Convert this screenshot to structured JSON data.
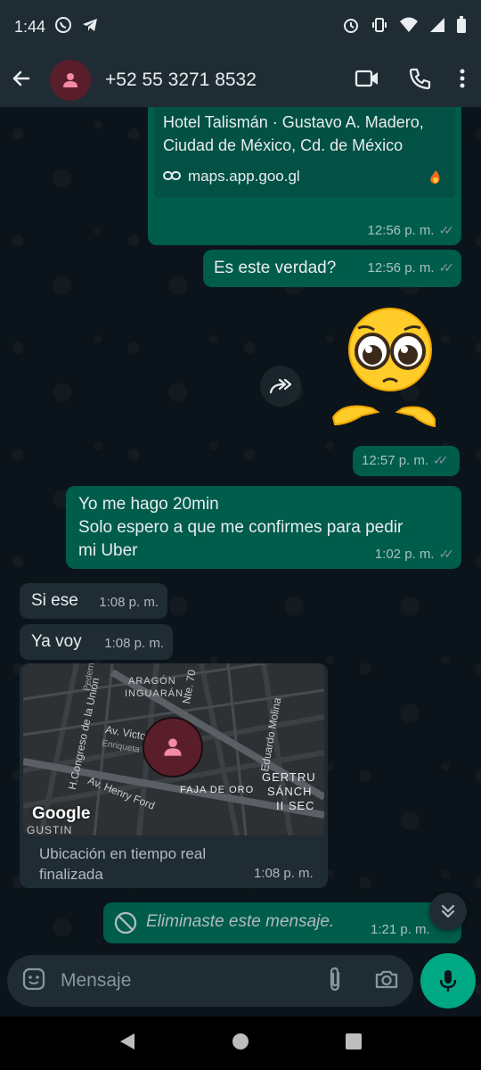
{
  "status_bar": {
    "time": "1:44"
  },
  "header": {
    "contact": "+52 55 3271 8532"
  },
  "messages": {
    "link": {
      "title": "Hotel Talismán · Gustavo A. Madero, Ciudad de México, Cd. de México",
      "title_line1": "Hotel Talismán · Gustavo A. Madero,",
      "title_line2": "Ciudad de México, Cd. de México",
      "url": "maps.app.goo.gl",
      "time": "12:56 p. m."
    },
    "m1": {
      "text": "Es este verdad?",
      "time": "12:56 p. m."
    },
    "sticker": {
      "time": "12:57 p. m."
    },
    "m2": {
      "line1": "Yo me hago 20min",
      "line2": "Solo espero a que me confirmes para pedir",
      "line3": "mi Uber",
      "time": "1:02 p. m."
    },
    "m3": {
      "text": "Si ese",
      "time": "1:08 p. m."
    },
    "m4": {
      "text": "Ya voy",
      "time": "1:08 p. m."
    },
    "location": {
      "line1": "Ubicación en tiempo real",
      "line2": "finalizada",
      "time": "1:08 p. m.",
      "map_labels": {
        "aragon": "ARAGÓN",
        "inguaran": "INGUARÁN",
        "union": "H.Congreso de la Unión",
        "victoria": "Av. Victoria",
        "henry": "Av. Henry Ford",
        "faja": "FAJA DE ORO",
        "eduardo": "Eduardo Molina",
        "gertru": "GERTRU",
        "sanch": "SÁNCH",
        "iisec": "II SEC",
        "google": "Google",
        "gustin": "GUSTIN",
        "nte70": "Nte. 70",
        "pedernal": "Pedernal",
        "enriqueta": "Enriqueta"
      }
    },
    "deleted": {
      "text": "Eliminaste este mensaje.",
      "time": "1:21 p. m."
    }
  },
  "input": {
    "placeholder": "Mensaje"
  },
  "colors": {
    "outgoing": "#005c4b",
    "incoming": "#202c33",
    "accent": "#00a884",
    "background": "#0b141a"
  }
}
